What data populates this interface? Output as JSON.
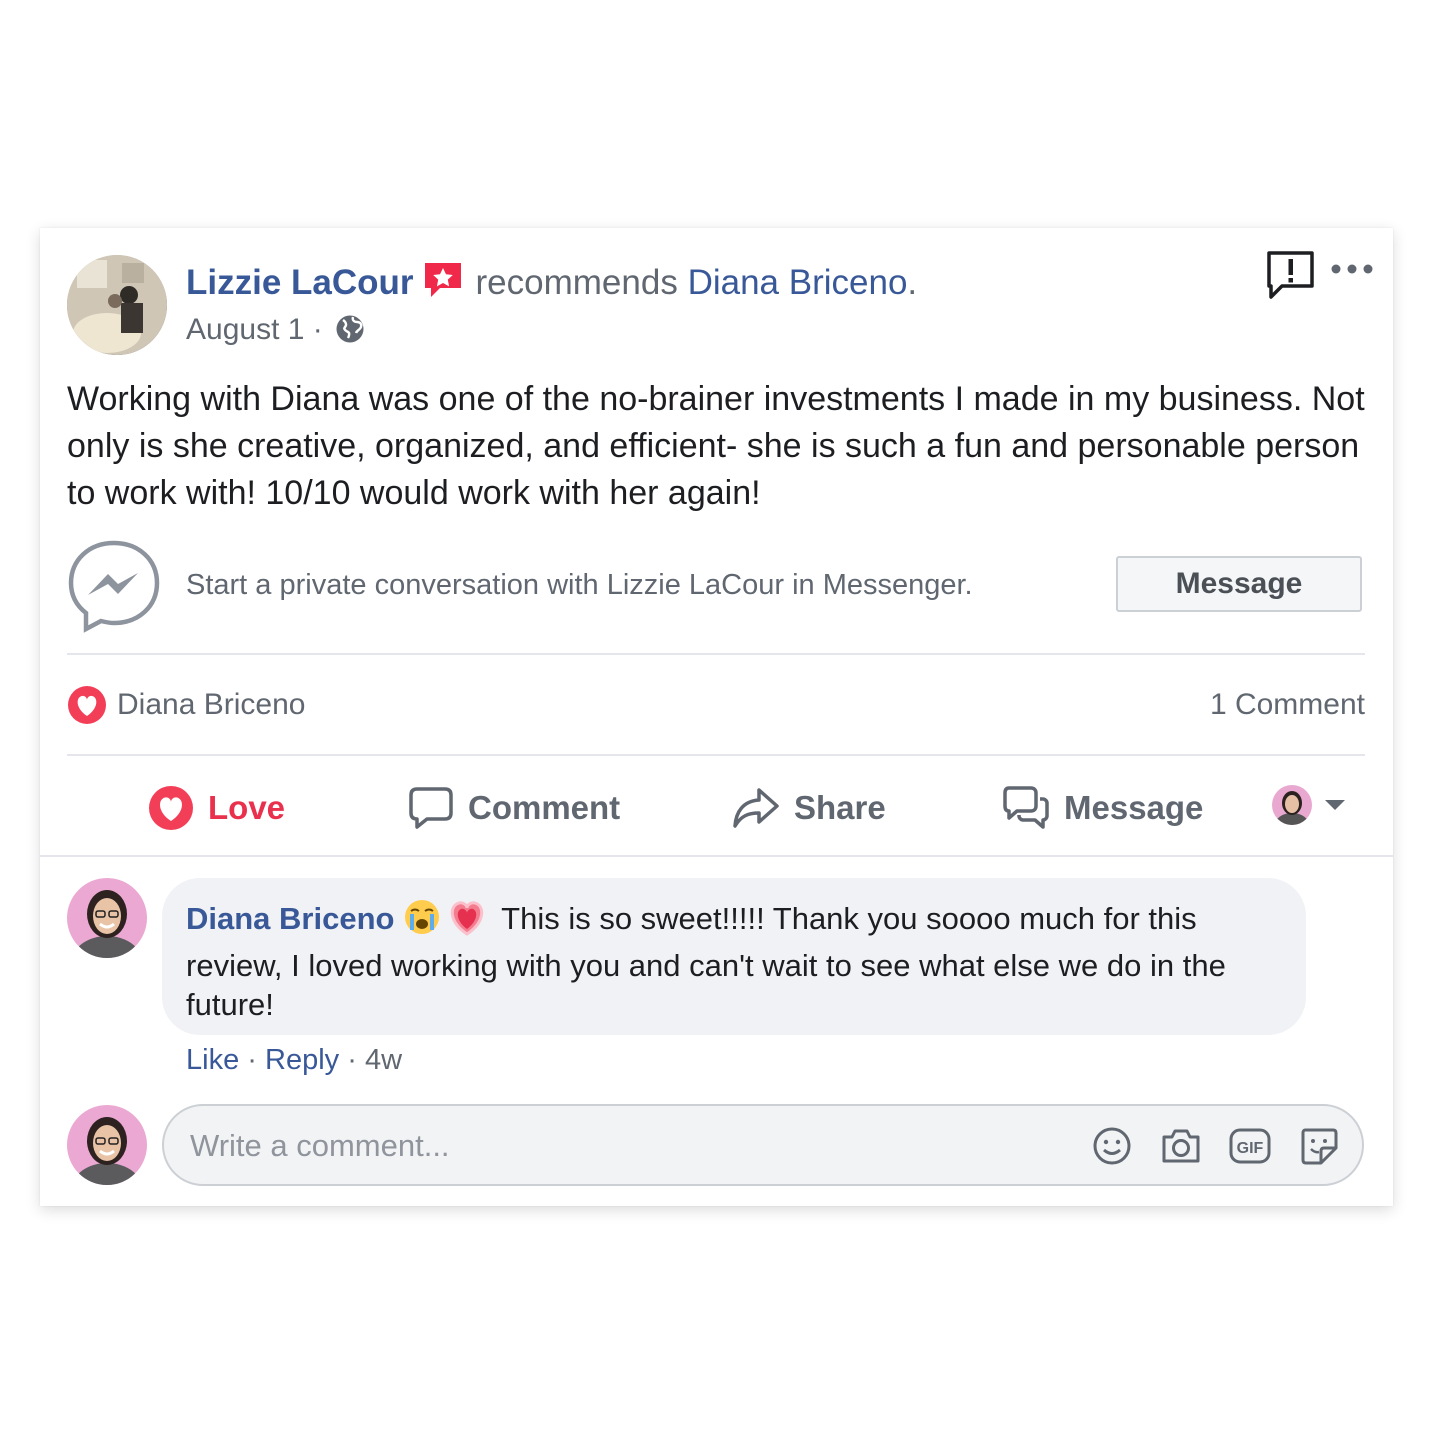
{
  "post": {
    "author_name": "Lizzie LaCour",
    "verb": "recommends",
    "recommended_name": "Diana Briceno",
    "recommended_suffix": ".",
    "date": "August 1",
    "meta_separator": "·",
    "body": "Working with Diana was one of the no-brainer investments I made in my business. Not only is she creative, organized, and efficient- she is such a fun and personable person to work with! 10/10 would work with her again!"
  },
  "messenger": {
    "prompt": "Start a private conversation with Lizzie LaCour in Messenger.",
    "button_label": "Message"
  },
  "reactions": {
    "reactor_name": "Diana Briceno",
    "comment_count": "1 Comment"
  },
  "actions": {
    "love": "Love",
    "comment": "Comment",
    "share": "Share",
    "message": "Message"
  },
  "comment": {
    "author_name": "Diana Briceno",
    "text": "This is so sweet!!!!! Thank you soooo much for this review, I loved working with you and can't wait to see what else we do in the future!",
    "like_label": "Like",
    "reply_label": "Reply",
    "separator": "·",
    "age": "4w"
  },
  "composer": {
    "placeholder": "Write a comment..."
  },
  "colors": {
    "link": "#385898",
    "love": "#e9304d",
    "muted": "#606770",
    "bubble": "#f0f2f5"
  },
  "icons": [
    "avatar",
    "recommendation-star-icon",
    "globe-icon",
    "report-icon",
    "more-icon",
    "messenger-icon",
    "love-heart-icon",
    "comment-icon",
    "share-icon",
    "message-icon",
    "chevron-down-icon",
    "crying-emoji-icon",
    "heart-emoji-icon",
    "smiley-icon",
    "camera-icon",
    "gif-icon",
    "sticker-icon"
  ]
}
